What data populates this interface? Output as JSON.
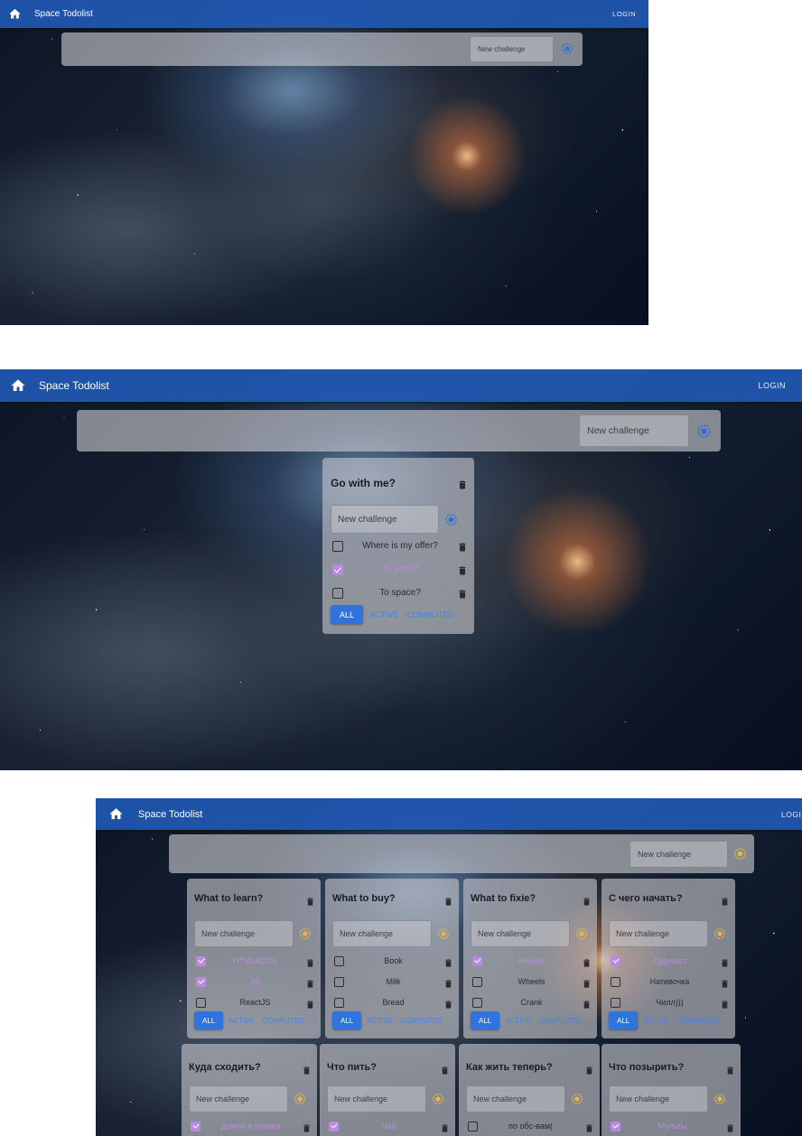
{
  "app": {
    "title": "Space Todolist",
    "login_label": "LOGIN",
    "add_placeholder": "New challenge"
  },
  "filters": [
    "ALL",
    "ACTIVE",
    "COMPLITED"
  ],
  "shot2_card": {
    "title": "Go with me?",
    "tasks": [
      {
        "text": "Where is my offer?",
        "done": false
      },
      {
        "text": "To work?",
        "done": true
      },
      {
        "text": "To space?",
        "done": false
      }
    ]
  },
  "shot3_cards_row1": [
    {
      "title": "What to learn?",
      "tasks": [
        {
          "text": "HTML&CSS",
          "done": true
        },
        {
          "text": "JS",
          "done": true
        },
        {
          "text": "ReactJS",
          "done": false
        }
      ]
    },
    {
      "title": "What to buy?",
      "tasks": [
        {
          "text": "Book",
          "done": false
        },
        {
          "text": "Milk",
          "done": false
        },
        {
          "text": "Bread",
          "done": false
        }
      ]
    },
    {
      "title": "What to fixie?",
      "tasks": [
        {
          "text": "Helmet",
          "done": true
        },
        {
          "text": "Wheels",
          "done": false
        },
        {
          "text": "Crank",
          "done": false
        }
      ]
    },
    {
      "title": "С чего начать?",
      "tasks": [
        {
          "text": "Тудулист",
          "done": true
        },
        {
          "text": "Нативочка",
          "done": false
        },
        {
          "text": "Чилл)))",
          "done": false
        }
      ]
    }
  ],
  "shot3_cards_row2": [
    {
      "title": "Куда сходить?",
      "tasks": [
        {
          "text": "Домой в универ",
          "done": true
        }
      ]
    },
    {
      "title": "Что пить?",
      "tasks": [
        {
          "text": "Чай",
          "done": true
        }
      ]
    },
    {
      "title": "Как жить теперь?",
      "tasks": [
        {
          "text": "по обс-вам(",
          "done": false
        }
      ]
    },
    {
      "title": "Что позырить?",
      "tasks": [
        {
          "text": "Мульты",
          "done": true
        }
      ]
    }
  ],
  "colors": {
    "appbar": "#215bba",
    "filter_active": "#2f74de",
    "filter_text": "#3f86e6",
    "done_text": "#b88be0",
    "add_icon_blue": "#2b6fe0",
    "add_icon_gold": "#e6b84a"
  },
  "icons": [
    "home-icon",
    "add-circle-icon",
    "trash-icon",
    "checkbox-icon"
  ]
}
